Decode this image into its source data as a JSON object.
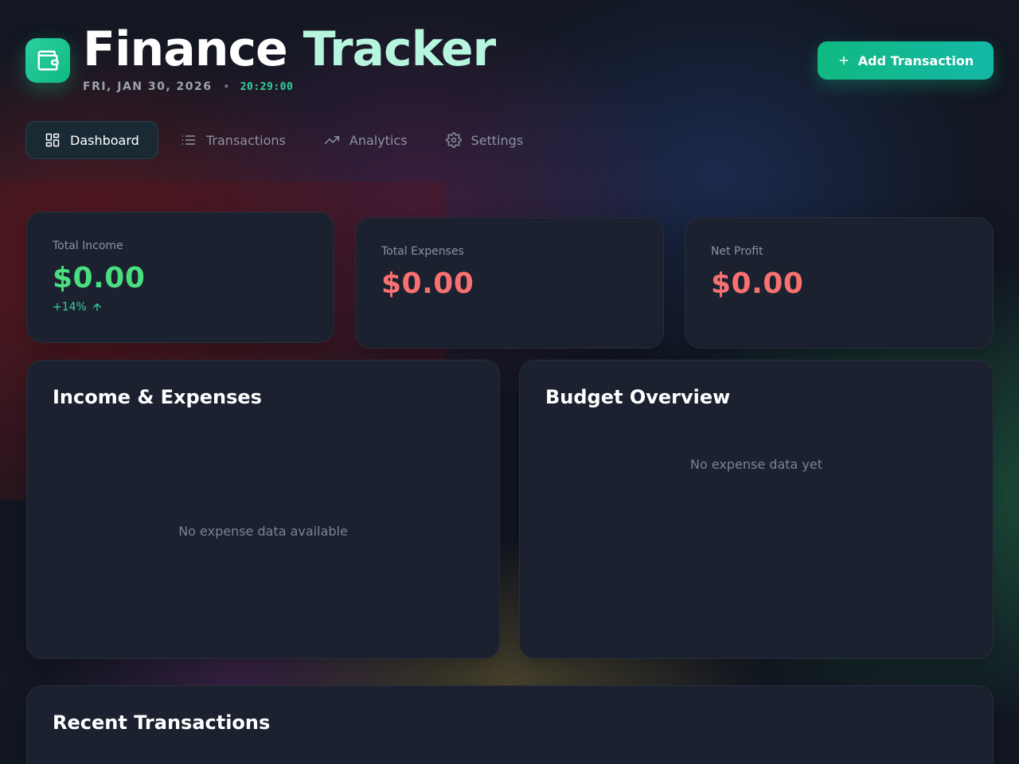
{
  "header": {
    "title_part1": "Finance",
    "title_part2": "Tracker",
    "date": "FRI, JAN 30, 2026",
    "separator": "•",
    "time": "20:29:00",
    "add_button_label": "Add Transaction"
  },
  "nav": {
    "items": [
      {
        "label": "Dashboard",
        "icon": "grid-icon",
        "active": true
      },
      {
        "label": "Transactions",
        "icon": "list-icon",
        "active": false
      },
      {
        "label": "Analytics",
        "icon": "trending-up-icon",
        "active": false
      },
      {
        "label": "Settings",
        "icon": "gear-icon",
        "active": false
      }
    ]
  },
  "stats": [
    {
      "label": "Total Income",
      "value": "$0.00",
      "trend": "+14%",
      "color": "#4ade80"
    },
    {
      "label": "Total Expenses",
      "value": "$0.00",
      "color": "#f87171"
    },
    {
      "label": "Net Profit",
      "value": "$0.00",
      "color": "#f87171"
    }
  ],
  "panels": {
    "income_expenses": {
      "title": "Income & Expenses",
      "empty_text": "No expense data available"
    },
    "budget_overview": {
      "title": "Budget Overview",
      "empty_text": "No expense data yet"
    },
    "recent_transactions": {
      "title": "Recent Transactions"
    }
  },
  "colors": {
    "accent": "#10b981",
    "income": "#4ade80",
    "expense": "#f87171",
    "card_bg": "#1c2130"
  }
}
